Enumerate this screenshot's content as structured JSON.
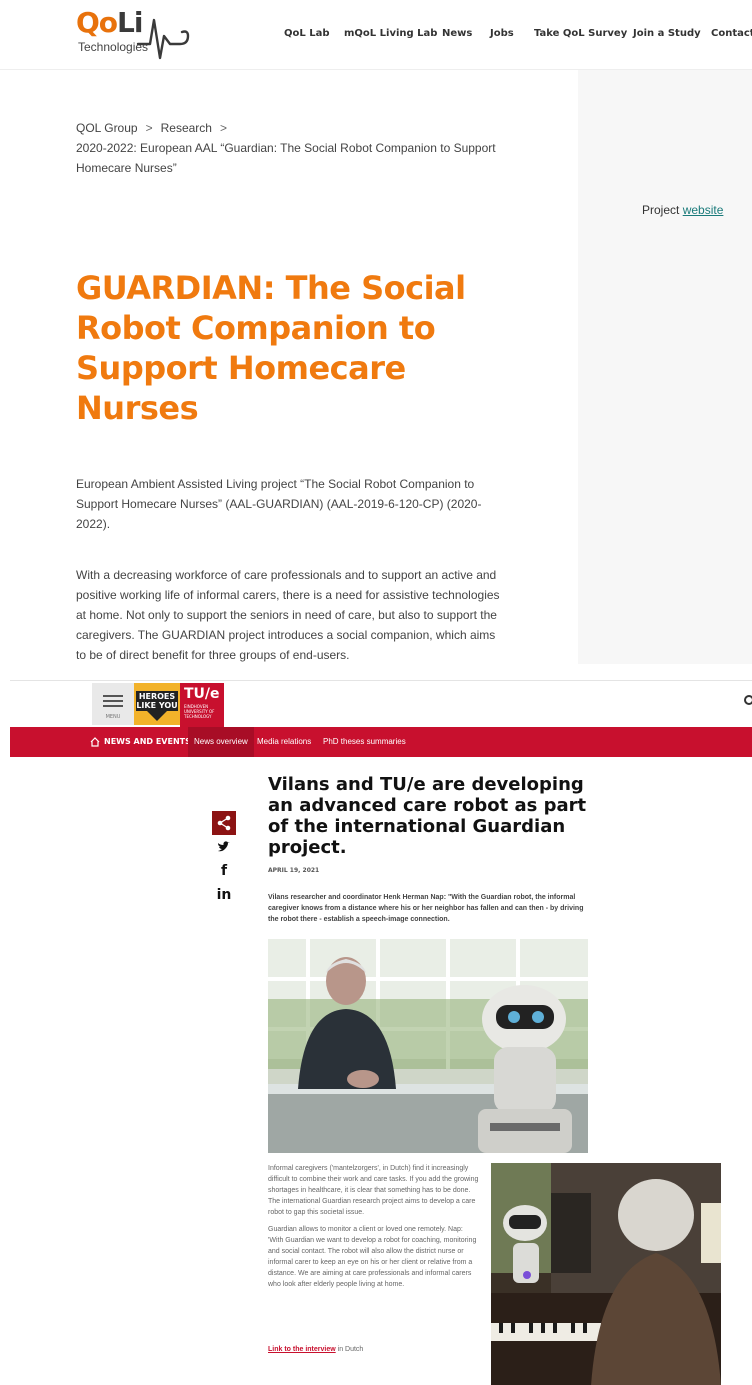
{
  "brand": {
    "logo_mark": "QoLife",
    "logo_sub": "Technologies"
  },
  "nav": {
    "items": [
      "QoL Lab",
      "mQoL Living Lab",
      "News",
      "Jobs",
      "Take QoL Survey",
      "Join a Study",
      "Contact"
    ]
  },
  "breadcrumb": {
    "group": "QOL Group",
    "research": "Research",
    "current": "2020-2022: European AAL “Guardian: The Social Robot Companion to Support Homecare Nurses”",
    "separator": ">"
  },
  "sidebar": {
    "project_label": "Project",
    "project_link": "website"
  },
  "article": {
    "title": "GUARDIAN: The Social Robot Companion to Support Homecare Nurses",
    "intro": "European Ambient Assisted Living project “The Social Robot Companion to Support Homecare Nurses” (AAL-GUARDIAN) (AAL-2019-6-120-CP) (2020-2022).",
    "body": "With a decreasing workforce of care professionals and to support an active and positive working life of informal carers, there is a need for assistive technologies at home. Not only to support the seniors in need of care, but also to support the caregivers. The GUARDIAN project introduces a social companion, which aims to be of direct benefit for three groups of end-users."
  },
  "tue": {
    "menu_label": "MENU",
    "heroes_label": "HEROES LIKE YOU",
    "logo": "TU/e",
    "logo_sub": "EINDHOVEN UNIVERSITY OF TECHNOLOGY",
    "section": "NEWS AND EVENTS",
    "subnav": [
      "News overview",
      "Media relations",
      "PhD theses summaries"
    ],
    "share_icons": [
      "share-icon",
      "twitter-icon",
      "facebook-icon",
      "linkedin-icon"
    ],
    "title": "Vilans and TU/e are developing an advanced care robot as part of the international Guardian project.",
    "date": "APRIL 19, 2021",
    "lead": "Vilans researcher and coordinator Henk Herman Nap: \"With the Guardian robot, the informal caregiver knows from a distance where his or her neighbor has fallen and can then - by driving the robot there - establish a speech-image connection.",
    "para1": "Informal caregivers ('mantelzorgers', in Dutch) find it increasingly difficult to combine their work and care tasks. If you add the growing shortages in healthcare, it is clear that something has to be done. The international Guardian research project aims to develop a care robot to gap this societal issue.",
    "para2": "Guardian allows to monitor a client or loved one remotely. Nap: 'With Guardian we want to develop a robot for coaching, monitoring and social contact. The robot will also allow the district nurse or informal carer to keep an eye on his or her client or relative from a distance. We are aiming at care professionals and informal carers who look after elderly people living at home.",
    "link_text": "Link to the interview",
    "link_suffix": "in Dutch"
  },
  "colors": {
    "accent_orange": "#f07a0f",
    "link_teal": "#1a7a7a",
    "tue_red": "#c8102e"
  }
}
